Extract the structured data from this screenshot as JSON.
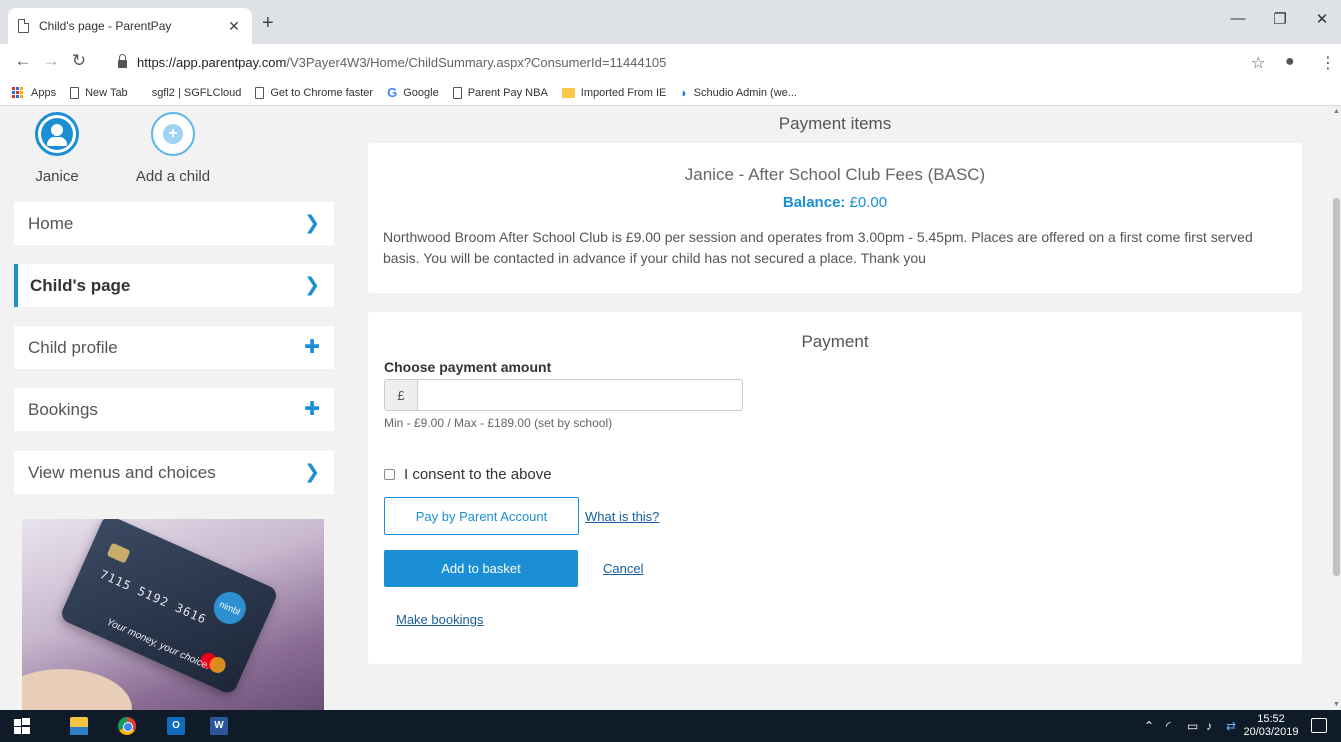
{
  "browser": {
    "tab_title": "Child's page - ParentPay",
    "url_host": "https://app.parentpay.com",
    "url_path": "/V3Payer4W3/Home/ChildSummary.aspx?ConsumerId=11444105",
    "bookmarks": [
      "Apps",
      "New Tab",
      "sgfl2 | SGFLCloud",
      "Get to Chrome faster",
      "Google",
      "Parent Pay NBA",
      "Imported From IE",
      "Schudio Admin (we..."
    ]
  },
  "children": {
    "selected_name": "Janice",
    "add_label": "Add a child"
  },
  "sidebar": {
    "items": [
      {
        "label": "Home",
        "icon": "chevron-right-icon"
      },
      {
        "label": "Child's page",
        "icon": "chevron-right-icon"
      },
      {
        "label": "Child profile",
        "icon": "plus-icon"
      },
      {
        "label": "Bookings",
        "icon": "plus-icon"
      },
      {
        "label": "View menus and choices",
        "icon": "chevron-right-icon"
      }
    ],
    "promo": {
      "card_number": "7115 5192 3616",
      "brand": "nimbl",
      "tagline": "Your money, your choice."
    }
  },
  "payment_items": {
    "heading": "Payment items",
    "title": "Janice - After School Club Fees (BASC)",
    "balance_label": "Balance:",
    "balance_value": "£0.00",
    "description": "Northwood Broom After School Club is £9.00 per session and operates from 3.00pm - 5.45pm. Places are offered on a first come first served basis. You will be contacted in advance if your child has not secured a place. Thank you"
  },
  "payment": {
    "heading": "Payment",
    "amount_label": "Choose payment amount",
    "currency_symbol": "£",
    "amount_value": "",
    "amount_help": "Min - £9.00 / Max - £189.00 (set by school)",
    "consent_label": "I consent to the above",
    "consent_checked": false,
    "pay_by_account_label": "Pay by Parent Account",
    "what_is_this_label": "What is this?",
    "add_to_basket_label": "Add to basket",
    "cancel_label": "Cancel",
    "make_bookings_label": "Make bookings"
  },
  "taskbar": {
    "time": "15:52",
    "date": "20/03/2019"
  },
  "colors": {
    "accent": "#1a8fd6",
    "link": "#1a5e9c",
    "taskbar": "#101b2a"
  }
}
